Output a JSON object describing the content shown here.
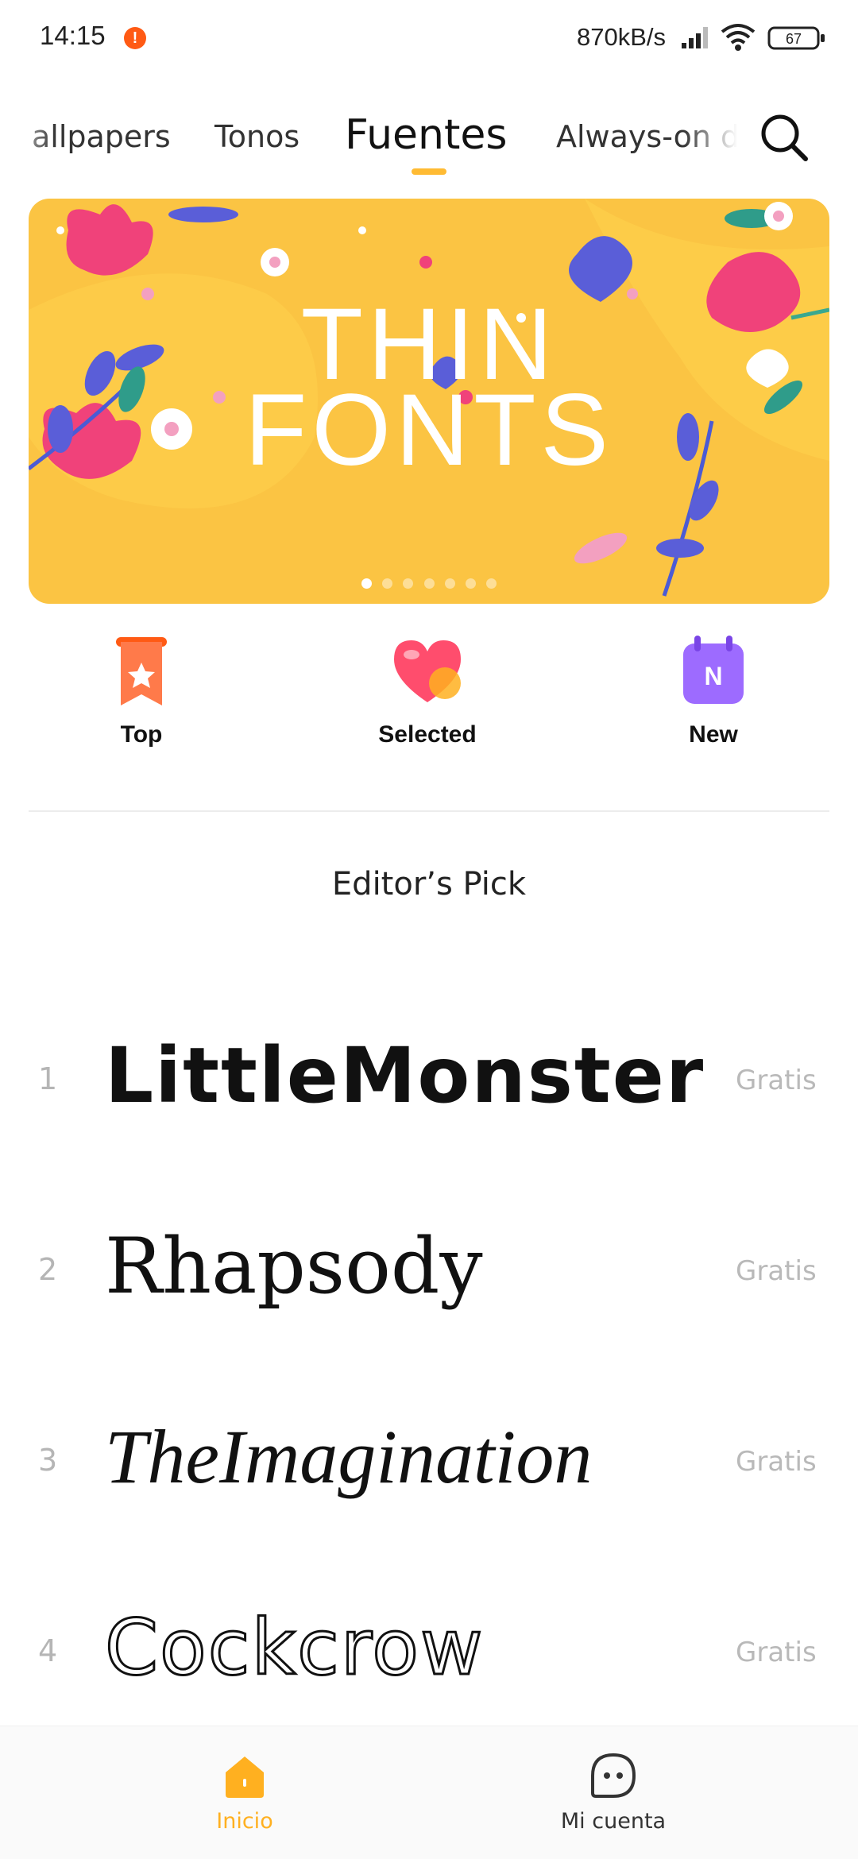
{
  "status_bar": {
    "time": "14:15",
    "net_speed": "870kB/s",
    "battery": "67",
    "icons": [
      "info-alert-icon",
      "signal-icon",
      "wifi-icon",
      "battery-icon"
    ]
  },
  "tabs": [
    {
      "label": "allpapers",
      "active": false
    },
    {
      "label": "Tonos",
      "active": false
    },
    {
      "label": "Fuentes",
      "active": true
    },
    {
      "label": "Always-on d",
      "active": false
    }
  ],
  "banner": {
    "title_line1": "THIN",
    "title_line2": "FONTS",
    "page_count": 7,
    "active_page": 1
  },
  "quick_nav": [
    {
      "label": "Top",
      "icon": "star-ribbon-icon"
    },
    {
      "label": "Selected",
      "icon": "heart-icon"
    },
    {
      "label": "New",
      "icon": "calendar-new-icon",
      "icon_text": "N"
    }
  ],
  "section": {
    "title": "Editor’s Pick"
  },
  "font_list": [
    {
      "index": "1",
      "name": "LittleMonster",
      "price": "Gratis"
    },
    {
      "index": "2",
      "name": "Rhapsody",
      "price": "Gratis"
    },
    {
      "index": "3",
      "name": "TheImagination",
      "price": "Gratis"
    },
    {
      "index": "4",
      "name": "Cockcrow",
      "price": "Gratis"
    }
  ],
  "bottom_nav": [
    {
      "label": "Inicio",
      "icon": "home-icon",
      "active": true
    },
    {
      "label": "Mi cuenta",
      "icon": "account-face-icon",
      "active": false
    }
  ],
  "colors": {
    "accent": "#ffb020",
    "banner_bg": "#fbc443",
    "price_text": "#b9b9b9",
    "quick_top": "#ff6a3d",
    "quick_selected": "#ff4d6d",
    "quick_new": "#9d6bff"
  }
}
